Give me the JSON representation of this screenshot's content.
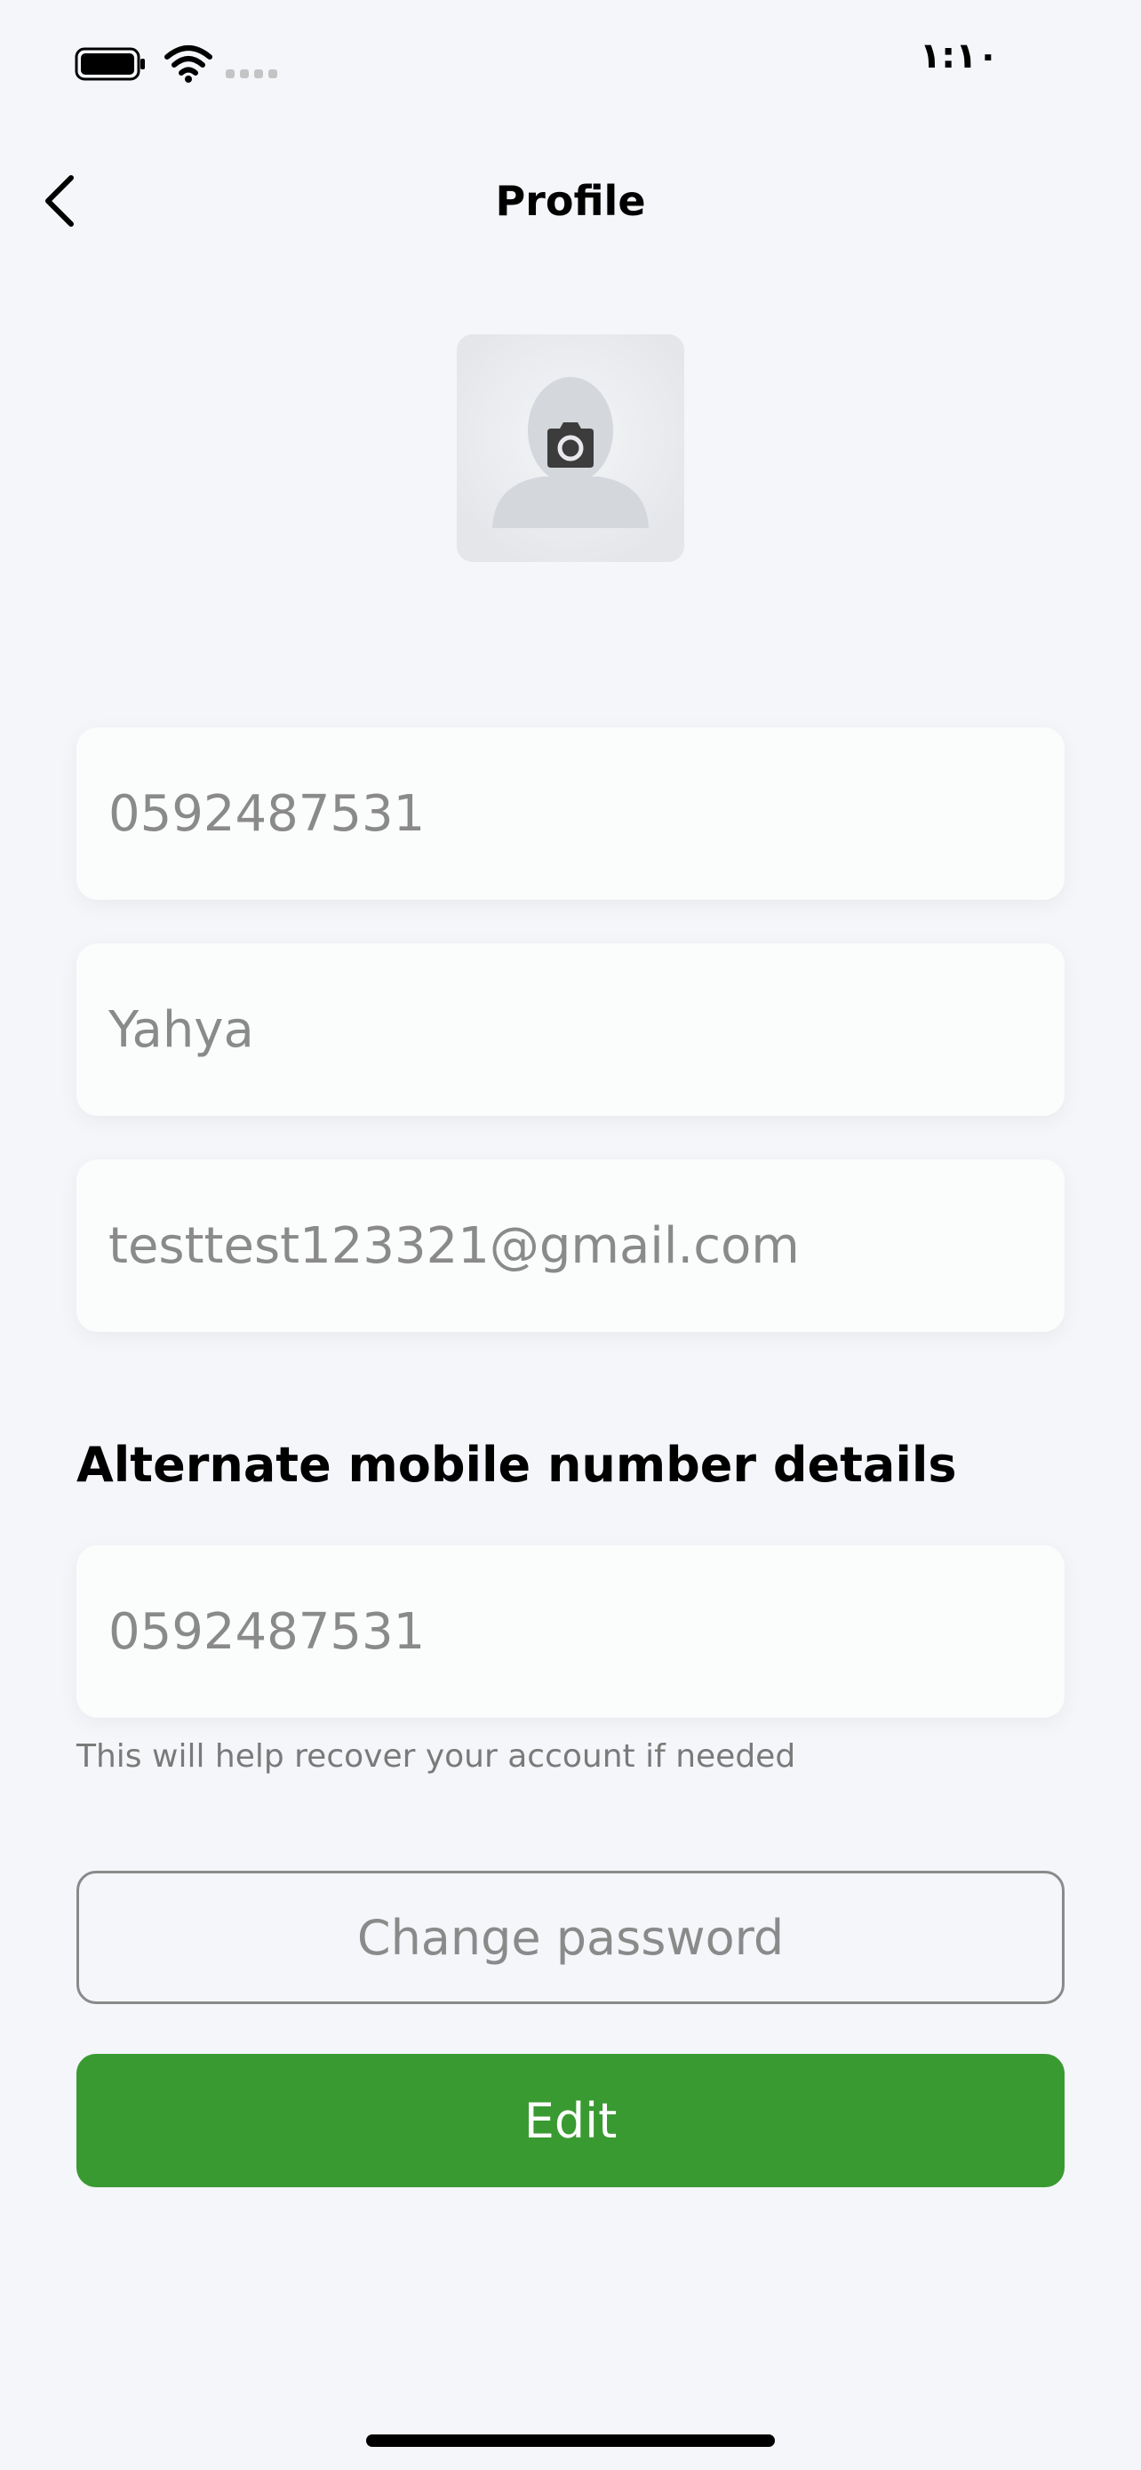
{
  "status_bar": {
    "time": "١:١٠",
    "icons": [
      "battery-icon",
      "wifi-icon",
      "signal-icon"
    ]
  },
  "header": {
    "title": "Profile",
    "back_icon": "chevron-left-icon"
  },
  "avatar": {
    "placeholder_icon": "person-silhouette-icon",
    "overlay_icon": "camera-icon"
  },
  "fields": {
    "phone": "0592487531",
    "name": "Yahya",
    "email": "testtest123321@gmail.com"
  },
  "alternate": {
    "heading": "Alternate mobile number details",
    "phone": "0592487531",
    "helper": "This will help recover your account if needed"
  },
  "buttons": {
    "change_password": "Change password",
    "edit": "Edit"
  },
  "colors": {
    "background": "#f4f6f9",
    "primary": "#3a9a32",
    "field_bg": "#fbfcfc",
    "muted_text": "#8a8a8a"
  }
}
